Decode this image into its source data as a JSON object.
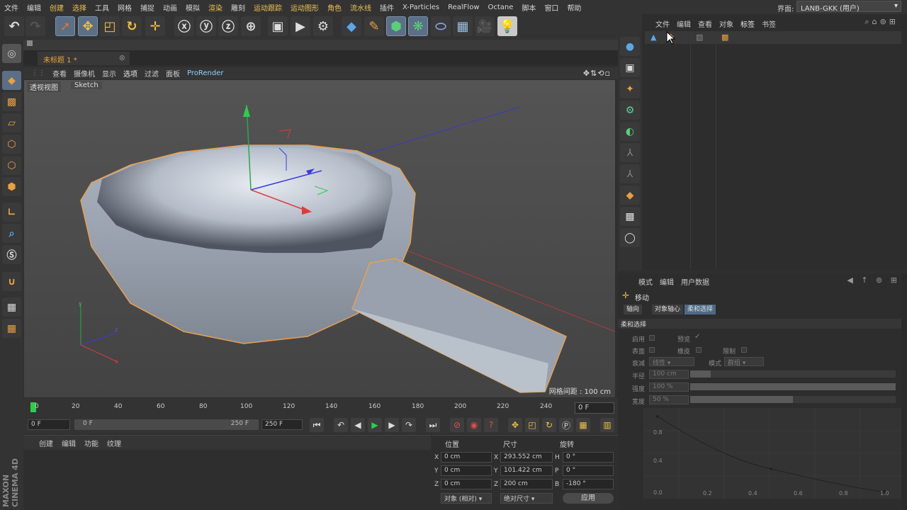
{
  "menu": {
    "items": [
      "文件",
      "编辑",
      "创建",
      "选择",
      "工具",
      "网格",
      "捕捉",
      "动画",
      "模拟",
      "渲染",
      "雕刻",
      "运动跟踪",
      "运动图形",
      "角色",
      "流水线",
      "插件",
      "X-Particles",
      "RealFlow",
      "Octane",
      "脚本",
      "窗口",
      "帮助"
    ],
    "layout_label": "界面:",
    "layout_value": "LANB-GKK (用户)"
  },
  "document": {
    "tab_title": "未标题 1 *"
  },
  "viewport_menu": {
    "items": [
      "查看",
      "摄像机",
      "显示",
      "选项",
      "过滤",
      "面板",
      "ProRender"
    ],
    "view_label": "透视视图",
    "sketch_label": "Sketch",
    "grid_spacing": "网格间距 : 100 cm"
  },
  "timeline": {
    "ticks": [
      "0",
      "20",
      "40",
      "60",
      "80",
      "100",
      "120",
      "140",
      "160",
      "180",
      "200",
      "220",
      "240"
    ],
    "current_frame": "0 F",
    "start_field": "0 F",
    "range_start": "0 F",
    "range_end": "250 F",
    "end_field": "250 F"
  },
  "material_panel": {
    "menu": [
      "创建",
      "编辑",
      "功能",
      "纹理"
    ]
  },
  "coordinates": {
    "headers": [
      "位置",
      "尺寸",
      "旋转"
    ],
    "rows": [
      {
        "pos_axis": "X",
        "pos": "0 cm",
        "size_axis": "X",
        "size": "293.552 cm",
        "rot_axis": "H",
        "rot": "0 °"
      },
      {
        "pos_axis": "Y",
        "pos": "0 cm",
        "size_axis": "Y",
        "size": "101.422 cm",
        "rot_axis": "P",
        "rot": "0 °"
      },
      {
        "pos_axis": "Z",
        "pos": "0 cm",
        "size_axis": "Z",
        "size": "200 cm",
        "rot_axis": "B",
        "rot": "-180 °"
      }
    ],
    "mode_dropdown": "对象 (相对)",
    "size_dropdown": "绝对尺寸",
    "apply_button": "应用"
  },
  "object_manager": {
    "menu": [
      "文件",
      "编辑",
      "查看",
      "对象",
      "标签",
      "书签"
    ]
  },
  "attribute_manager": {
    "menu": [
      "模式",
      "编辑",
      "用户数据"
    ],
    "tool_name": "移动",
    "tabs": [
      "轴向",
      "对象轴心",
      "柔和选择"
    ],
    "section_title": "柔和选择",
    "enable_label": "启用",
    "preview_label": "预览",
    "surface_label": "表面",
    "rubber_label": "橡皮",
    "restrict_label": "限制",
    "falloff_label": "衰减",
    "falloff_value": "线性",
    "mode_label": "模式",
    "mode_value": "群组",
    "radius_label": "半径",
    "radius_value": "100 cm",
    "radius_fraction": 0.1,
    "strength_label": "强度",
    "strength_value": "100 %",
    "strength_fraction": 1.0,
    "width_label": "宽度",
    "width_value": "50 %",
    "width_fraction": 0.5,
    "graph_x_ticks": [
      "0.0",
      "0.2",
      "0.4",
      "0.6",
      "0.8",
      "1.0"
    ],
    "graph_y_ticks": [
      "0.8",
      "0.4",
      "0.0"
    ]
  },
  "brand": "MAXON CINEMA 4D",
  "colors": {
    "accent": "#e8a33a",
    "selection_blue": "#5b6f86"
  }
}
